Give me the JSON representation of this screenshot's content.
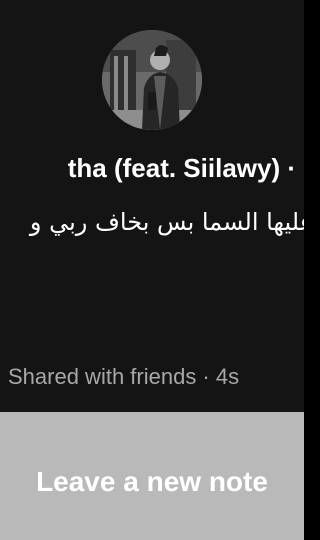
{
  "note": {
    "song_text": "tha (feat. Siilawy) · B",
    "body_text": "عليها السما بس بخاف ربي و",
    "meta_text": "Shared with friends · 4s"
  },
  "actions": {
    "leave_note_label": "Leave a new note"
  },
  "colors": {
    "panel_background": "#141414",
    "button_background": "#b9b9b9",
    "meta_text": "#a8a8a8"
  }
}
